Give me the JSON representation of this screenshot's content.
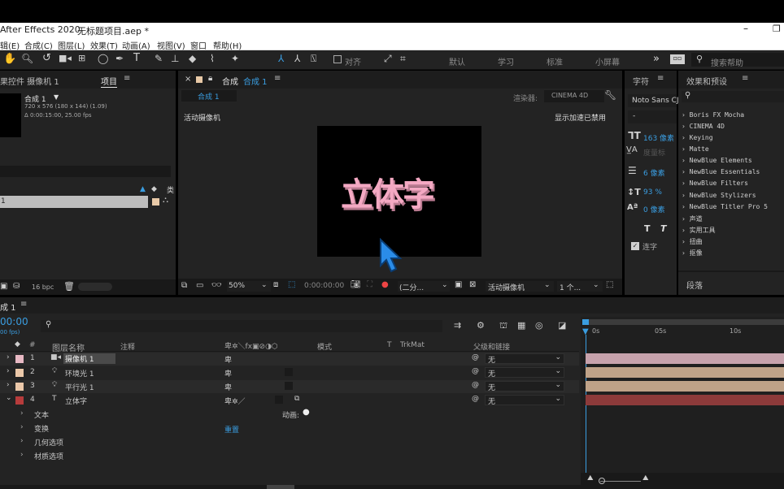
{
  "app": {
    "title": "After Effects 2020",
    "project": "无标题项目.aep *"
  },
  "menu": [
    "辑(E)",
    "合成(C)",
    "图层(L)",
    "效果(T)",
    "动画(A)",
    "视图(V)",
    "窗口",
    "帮助(H)"
  ],
  "toolbar": {
    "align": "对齐",
    "workspaces": [
      "默认",
      "学习",
      "标准",
      "小屏幕"
    ],
    "more": "»",
    "search_placeholder": "搜索帮助"
  },
  "project_panel": {
    "tab_effects": "果控件 摄像机 1",
    "tab_project": "项目",
    "comp_name": "合成 1",
    "comp_info1": "720 x 576 (180 x 144) (1.09)",
    "comp_info2": "Δ 0:00:15:00, 25.00 fps",
    "list_item": "1",
    "bpc": "16 bpc"
  },
  "comp_panel": {
    "tab_label": "合成",
    "tab_name": "合成 1",
    "subtab": "合成 1",
    "renderer_label": "渲染器:",
    "renderer": "CINEMA 4D",
    "active_camera": "活动摄像机",
    "gpu_text": "显示加速已禁用",
    "canvas_text": "立体字",
    "zoom": "50%",
    "timecode": "0:00:00:00",
    "resolution": "(二分...",
    "camera_view": "活动摄像机",
    "view_count": "1 个..."
  },
  "character_panel": {
    "title": "字符",
    "font": "Noto Sans CJ",
    "font_style": "-",
    "size_value": "163 像素",
    "kerning_value": "度量标",
    "leading_value": "6 像素",
    "vscale_value": "93 %",
    "baseline_value": "0 像素",
    "faux_bold": "T",
    "faux_italic": "T",
    "hyphen_label": "连字"
  },
  "effects_panel": {
    "title": "效果和预设",
    "items": [
      "Boris FX Mocha",
      "CINEMA 4D",
      "Keying",
      "Matte",
      "NewBlue Elements",
      "NewBlue Essentials",
      "NewBlue Filters",
      "NewBlue Stylizers",
      "NewBlue Titler Pro 5",
      "声道",
      "实用工具",
      "扭曲",
      "抠像"
    ],
    "paragraph_title": "段落"
  },
  "timeline": {
    "tab": "成 1",
    "timecode": "00:00",
    "fps": "00 fps)",
    "headers": {
      "name": "图层名称",
      "comment": "注释",
      "mode": "模式",
      "t": "T",
      "trkmat": "TrkMat",
      "parent": "父级和链接"
    },
    "ruler": [
      "0s",
      "05s",
      "10s"
    ],
    "layers": [
      {
        "num": "1",
        "name": "摄像机 1",
        "color": "#e8b9c4",
        "bar": "#c7a2ac",
        "icon": "camera-icon"
      },
      {
        "num": "2",
        "name": "环境光 1",
        "color": "#ebc8a9",
        "bar": "#bfa288",
        "icon": "light-icon"
      },
      {
        "num": "3",
        "name": "平行光 1",
        "color": "#ebc8a9",
        "bar": "#bfa288",
        "icon": "light-icon"
      },
      {
        "num": "4",
        "name": "立体字",
        "color": "#b73c3c",
        "bar": "#8c3a3a",
        "icon": "text-icon"
      }
    ],
    "parent_value": "无",
    "props": [
      "文本",
      "变换",
      "几何选项",
      "材质选项"
    ],
    "animate_label": "动画:",
    "reset_label": "重置"
  }
}
